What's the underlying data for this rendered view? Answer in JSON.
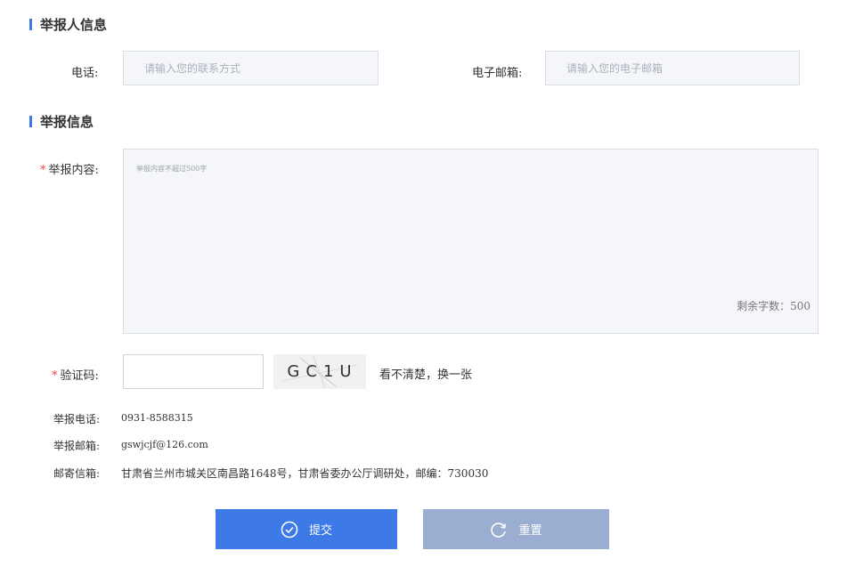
{
  "reporter_section": {
    "title": "举报人信息"
  },
  "phone": {
    "label": "电话:",
    "placeholder": "请输入您的联系方式"
  },
  "email": {
    "label": "电子邮箱:",
    "placeholder": "请输入您的电子邮箱"
  },
  "report_section": {
    "title": "举报信息"
  },
  "content": {
    "required_mark": "*",
    "label": "举报内容:",
    "placeholder": "举报内容不超过500字",
    "remaining": "剩余字数：500"
  },
  "captcha": {
    "required_mark": "*",
    "label": "验证码:",
    "value": "",
    "image_text": "GC1U",
    "refresh": "看不清楚，换一张"
  },
  "info": {
    "tel_label": "举报电话:",
    "tel_value": "0931-8588315",
    "mail_label": "举报邮箱:",
    "mail_value": "gswjcjf@126.com",
    "addr_label": "邮寄信箱:",
    "addr_value": "甘肃省兰州市城关区南昌路1648号，甘肃省委办公厅调研处，邮编：730030"
  },
  "actions": {
    "submit": "提交",
    "reset": "重置"
  },
  "icons": {
    "submit": "check-circle-icon",
    "reset": "refresh-icon"
  },
  "colors": {
    "accent": "#3d7ae8",
    "reset_button": "#9aaed2",
    "required": "#e84a4a"
  }
}
